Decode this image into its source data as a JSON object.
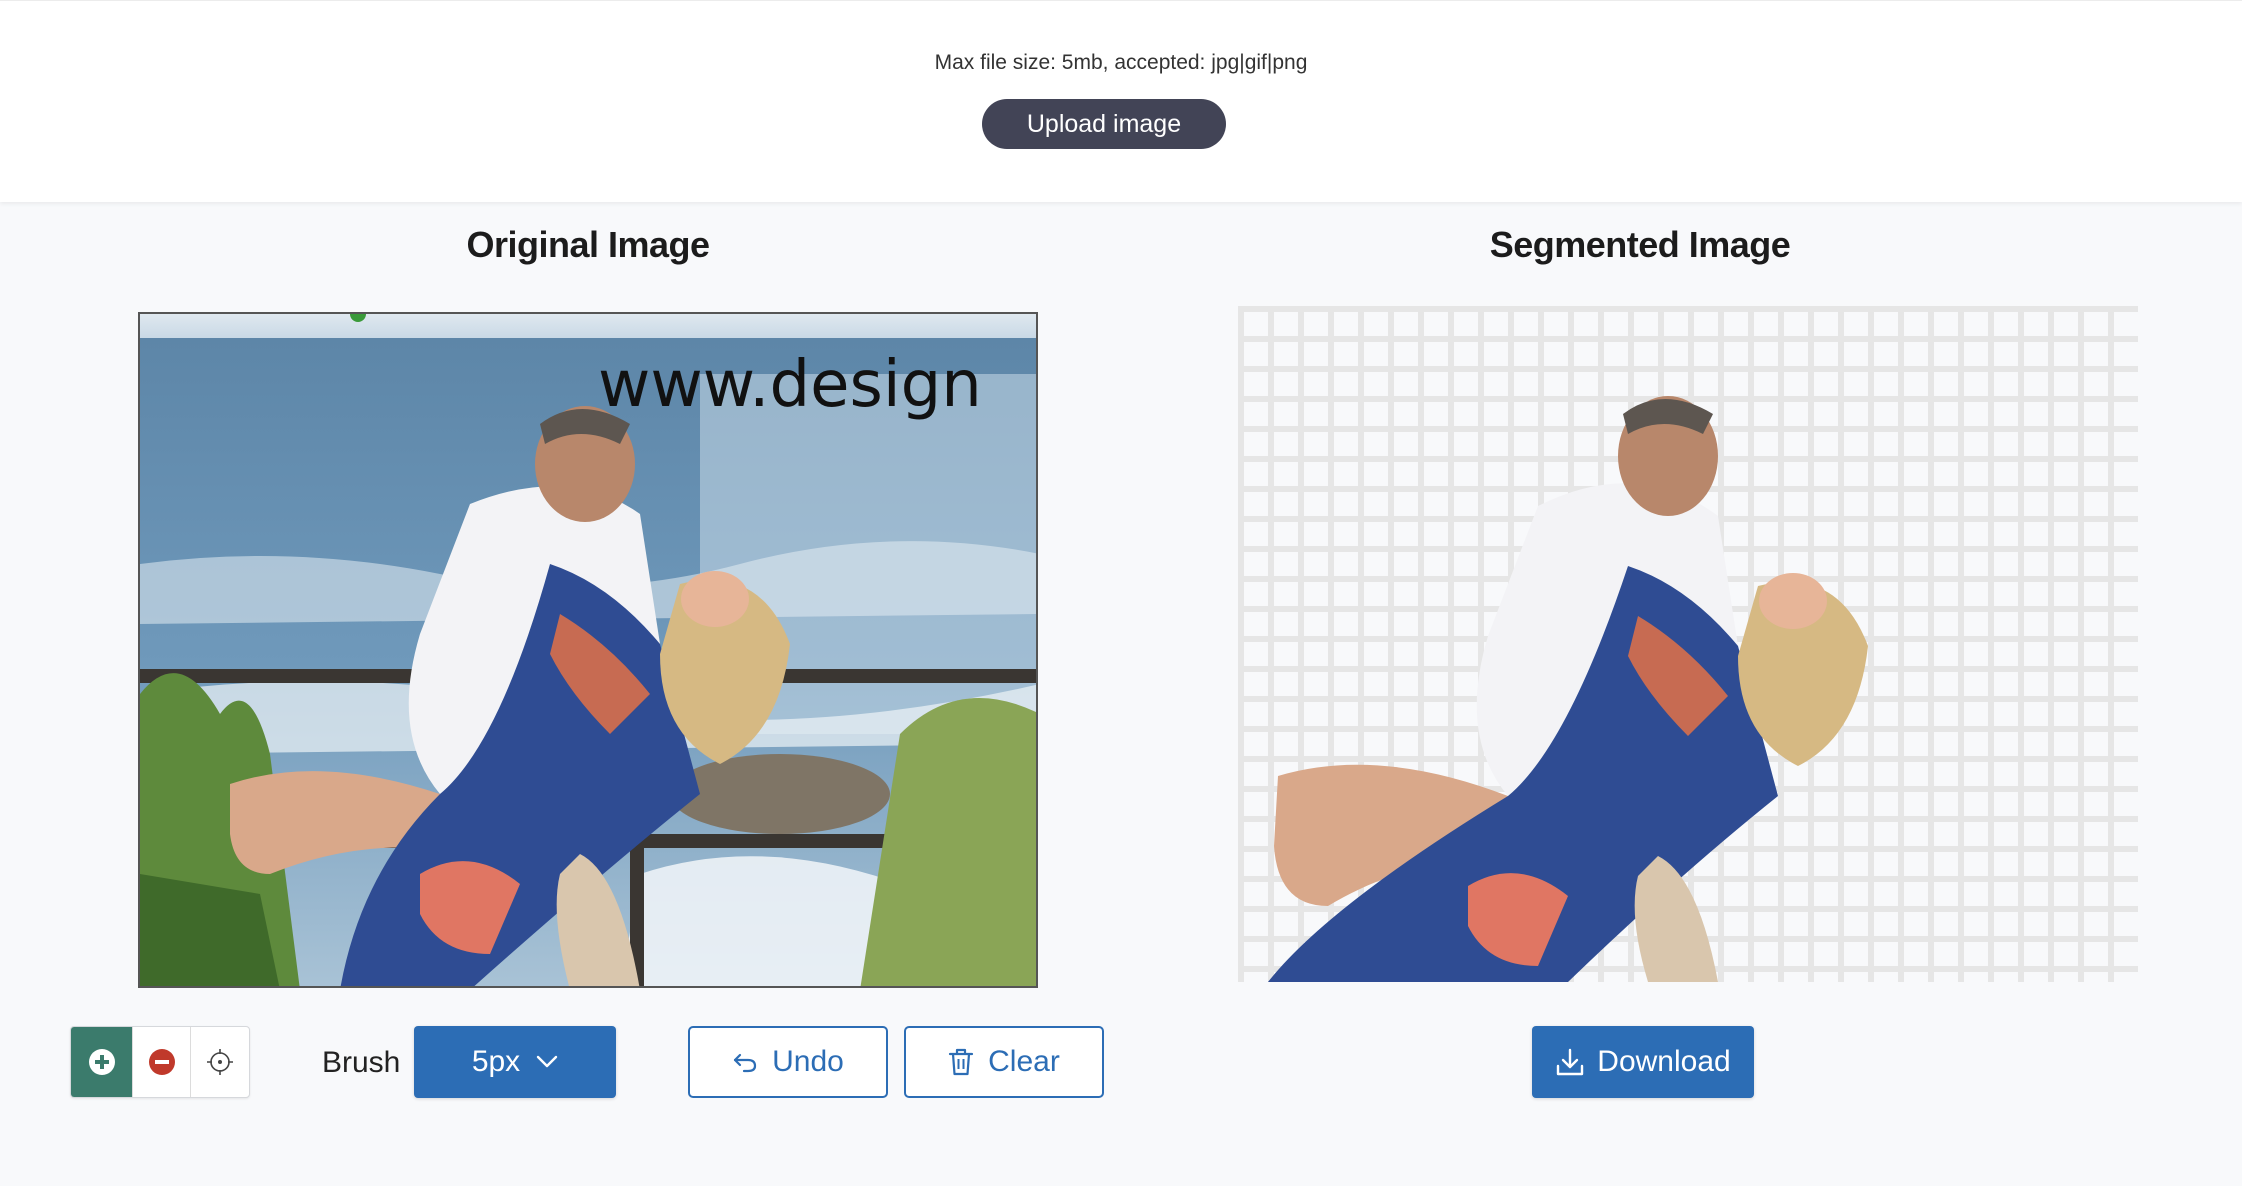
{
  "upload": {
    "hint": "Max file size: 5mb, accepted: jpg|gif|png",
    "button_label": "Upload image"
  },
  "original": {
    "title": "Original Image",
    "watermark": "www.design"
  },
  "segmented": {
    "title": "Segmented Image"
  },
  "toolbar": {
    "tools": [
      {
        "name": "add-brush",
        "icon": "plus-circle-icon",
        "color": "#3b7b6c"
      },
      {
        "name": "erase-brush",
        "icon": "minus-circle-icon",
        "color": "#c0392b"
      },
      {
        "name": "point-select",
        "icon": "crosshair-icon",
        "color": "#444444"
      }
    ],
    "brush_label": "Brush",
    "brush_size": "5px",
    "undo_label": "Undo",
    "clear_label": "Clear"
  },
  "download": {
    "label": "Download"
  },
  "colors": {
    "primary": "#2c6db5",
    "upload_button": "#424456",
    "active_tool": "#3b7b6c"
  }
}
